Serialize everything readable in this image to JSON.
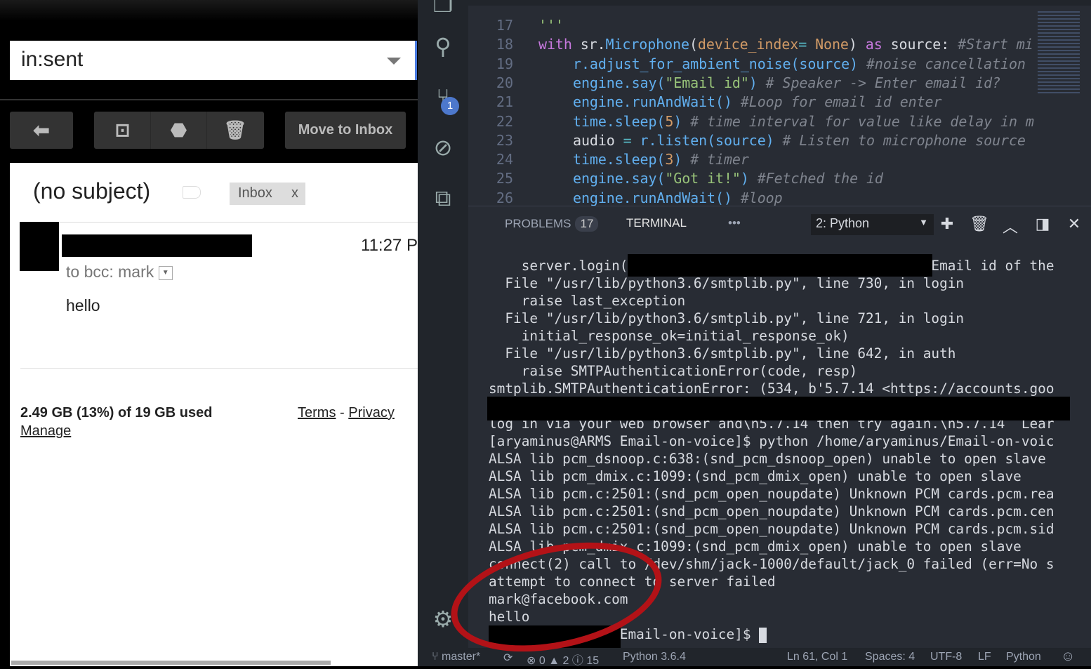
{
  "gmail": {
    "search_value": "in:sent",
    "toolbar": {
      "reply_icon": "reply-icon",
      "archive_icon": "archive-icon",
      "spam_icon": "report-spam-icon",
      "delete_icon": "trash-icon",
      "move_to_inbox": "Move to Inbox"
    },
    "message": {
      "subject": "(no subject)",
      "label": "Inbox",
      "label_remove": "x",
      "time": "11:27 P",
      "to": "to bcc: mark",
      "body": "hello"
    },
    "footer": {
      "storage": "2.49 GB (13%) of 19 GB used",
      "manage": "Manage",
      "terms": "Terms",
      "sep": "-",
      "privacy": "Privacy"
    }
  },
  "vscode": {
    "activity": [
      {
        "icon": "files-icon"
      },
      {
        "icon": "search-icon"
      },
      {
        "icon": "source-control-icon",
        "badge": "1"
      },
      {
        "icon": "debug-icon"
      },
      {
        "icon": "extensions-icon"
      },
      {
        "icon": "gear-icon"
      }
    ],
    "editor": {
      "lines": [
        {
          "n": "17",
          "indent": 0,
          "tokens": [
            [
              "'''",
              "s"
            ]
          ]
        },
        {
          "n": "18",
          "indent": 0,
          "tokens": [
            [
              "with",
              "k"
            ],
            [
              " sr.",
              "w"
            ],
            [
              "Microphone",
              "f"
            ],
            [
              "(",
              "w"
            ],
            [
              "device_index",
              "o"
            ],
            [
              "= ",
              "t"
            ],
            [
              "None",
              "o"
            ],
            [
              ") ",
              "w"
            ],
            [
              "as",
              "k"
            ],
            [
              " source: ",
              "w"
            ],
            [
              "#Start mi",
              "c"
            ]
          ]
        },
        {
          "n": "19",
          "indent": 1,
          "tokens": [
            [
              "r.",
              "f"
            ],
            [
              "adjust_for_ambient_noise",
              "f"
            ],
            [
              "(source) ",
              "f"
            ],
            [
              "#noise cancellation",
              "c"
            ]
          ]
        },
        {
          "n": "20",
          "indent": 1,
          "tokens": [
            [
              "engine.say(",
              "f"
            ],
            [
              "\"Email id\"",
              "s"
            ],
            [
              ") ",
              "f"
            ],
            [
              "# Speaker -> Enter email id?",
              "c"
            ]
          ]
        },
        {
          "n": "21",
          "indent": 1,
          "tokens": [
            [
              "engine.runAndWait() ",
              "f"
            ],
            [
              "#Loop for email id enter",
              "c"
            ]
          ]
        },
        {
          "n": "22",
          "indent": 1,
          "tokens": [
            [
              "time.sleep(",
              "f"
            ],
            [
              "5",
              "o"
            ],
            [
              ") ",
              "f"
            ],
            [
              "# time interval for value like delay in m",
              "c"
            ]
          ]
        },
        {
          "n": "23",
          "indent": 1,
          "tokens": [
            [
              "audio",
              "w"
            ],
            [
              " = ",
              "t"
            ],
            [
              "r.listen(source) ",
              "f"
            ],
            [
              "# Listen to microphone source",
              "c"
            ]
          ]
        },
        {
          "n": "24",
          "indent": 1,
          "tokens": [
            [
              "time.sleep(",
              "f"
            ],
            [
              "3",
              "o"
            ],
            [
              ") ",
              "f"
            ],
            [
              "# timer",
              "c"
            ]
          ]
        },
        {
          "n": "25",
          "indent": 1,
          "tokens": [
            [
              "engine.say(",
              "f"
            ],
            [
              "\"Got it!\"",
              "s"
            ],
            [
              ") ",
              "f"
            ],
            [
              "#Fetched the id",
              "c"
            ]
          ]
        },
        {
          "n": "26",
          "indent": 1,
          "tokens": [
            [
              "engine.runAndWait() ",
              "f"
            ],
            [
              "#loop",
              "c"
            ]
          ]
        }
      ]
    },
    "panel": {
      "problems_label": "PROBLEMS",
      "problems_count": "17",
      "terminal_label": "TERMINAL",
      "more": "•••",
      "terminal_select": "2: Python",
      "add_icon": "plus-icon",
      "trash_icon": "trash-icon",
      "maximize_icon": "chevron-up-icon",
      "split_icon": "split-icon",
      "close_icon": "close-icon",
      "terminal_lines": [
        "    server.login(                                    #Email id of the",
        "  File \"/usr/lib/python3.6/smtplib.py\", line 730, in login",
        "    raise last_exception",
        "  File \"/usr/lib/python3.6/smtplib.py\", line 721, in login",
        "    initial_response_ok=initial_response_ok)",
        "  File \"/usr/lib/python3.6/smtplib.py\", line 642, in auth",
        "    raise SMTPAuthenticationError(code, resp)",
        "smtplib.SMTPAuthenticationError: (534, b'5.7.14 <https://accounts.goo",
        "",
        "log in via your web browser and\\n5.7.14 then try again.\\n5.7.14  Lear",
        "[aryaminus@ARMS Email-on-voice]$ python /home/aryaminus/Email-on-voic",
        "ALSA lib pcm_dsnoop.c:638:(snd_pcm_dsnoop_open) unable to open slave",
        "ALSA lib pcm_dmix.c:1099:(snd_pcm_dmix_open) unable to open slave",
        "ALSA lib pcm.c:2501:(snd_pcm_open_noupdate) Unknown PCM cards.pcm.rea",
        "ALSA lib pcm.c:2501:(snd_pcm_open_noupdate) Unknown PCM cards.pcm.cen",
        "ALSA lib pcm.c:2501:(snd_pcm_open_noupdate) Unknown PCM cards.pcm.sid",
        "ALSA lib pcm_dmix.c:1099:(snd_pcm_dmix_open) unable to open slave",
        "connect(2) call to /dev/shm/jack-1000/default/jack_0 failed (err=No s",
        "attempt to connect to server failed",
        "mark@facebook.com",
        "hello",
        "                Email-on-voice]$ "
      ]
    },
    "status": {
      "branch": "master*",
      "errors": "0",
      "warnings": "2",
      "infos": "15",
      "interpreter": "Python 3.6.4",
      "position": "Ln 61, Col 1",
      "spaces": "Spaces: 4",
      "encoding": "UTF-8",
      "eol": "LF",
      "language": "Python",
      "feedback_icon": "smiley-icon"
    },
    "colors": {
      "annotation": "#b31217",
      "editor_bg": "#282c34",
      "accent": "#4d78cc"
    }
  }
}
